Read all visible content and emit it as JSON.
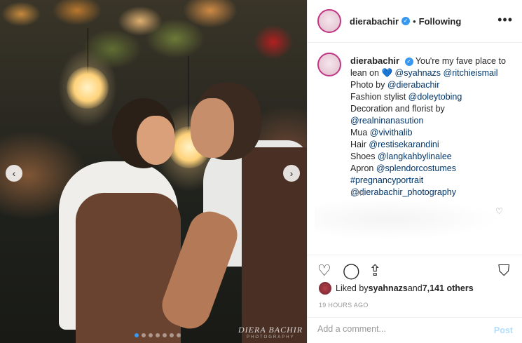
{
  "photo": {
    "watermark": "DIERA BACHIR",
    "watermark_sub": "PHOTOGRAPHY",
    "prev_icon": "chevron-left-icon",
    "next_icon": "chevron-right-icon",
    "prev_glyph": "‹",
    "next_glyph": "›",
    "carousel": {
      "count": 7,
      "active_index": 0
    }
  },
  "header": {
    "username": "dierabachir",
    "separator": "•",
    "follow_status": "Following",
    "more_glyph": "•••"
  },
  "caption": {
    "username": "dierabachir",
    "lines": [
      {
        "text_before": " You're my fave place to"
      },
      {
        "text_before": "lean on ",
        "heart": "💙",
        "tags": " @syahnazs @ritchieismail"
      },
      {
        "text": "Photo by ",
        "tag": "@dierabachir"
      },
      {
        "text": "Fashion stylist ",
        "tag": "@doleytobing"
      },
      {
        "text": "Decoration and florist by"
      },
      {
        "tag": "@realninanasution"
      },
      {
        "text": "Mua ",
        "tag": "@vivithalib"
      },
      {
        "text": "Hair ",
        "tag": "@restisekarandini"
      },
      {
        "text": "Shoes ",
        "tag": "@langkahbylinalee"
      },
      {
        "text": "Apron ",
        "tag": "@splendorcostumes"
      },
      {
        "tag": "#pregnancyportrait"
      },
      {
        "tag": "@dierabachir_photography"
      }
    ],
    "time": "19h",
    "like_glyph": "♡"
  },
  "actions": {
    "like_glyph": "♡",
    "comment_glyph": "◯",
    "share_glyph": "⇪",
    "save_glyph": "⛉"
  },
  "likes": {
    "prefix": "Liked by ",
    "user": "syahnazs",
    "middle": " and ",
    "count": "7,141 others"
  },
  "posted": "19 HOURS AGO",
  "comment_bar": {
    "placeholder": "Add a comment...",
    "post_label": "Post"
  },
  "colors": {
    "verified": "#3897f0",
    "link": "#003569",
    "post_disabled": "#b2dffc"
  }
}
